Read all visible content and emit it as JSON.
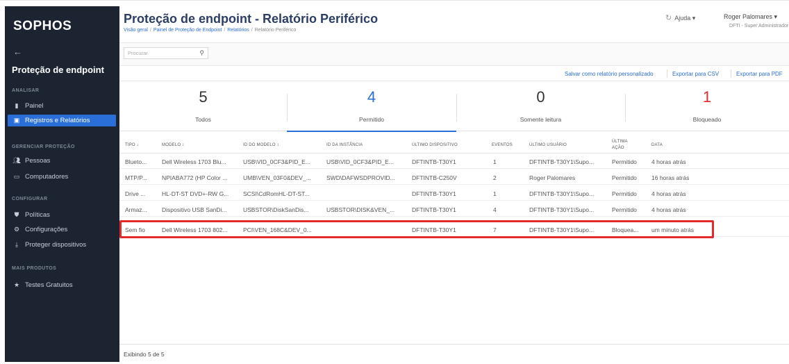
{
  "brand": {
    "logo": "SOPHOS"
  },
  "sidebar": {
    "back": "←",
    "section_title": "Proteção de endpoint",
    "groups": [
      {
        "label": "ANALISAR"
      },
      {
        "label": "GERENCIAR PROTEÇÃO"
      },
      {
        "label": "CONFIGURAR"
      },
      {
        "label": "MAIS PRODUTOS"
      }
    ],
    "items": [
      {
        "label": "Painel",
        "icon": "bar-chart-icon"
      },
      {
        "label": "Registros e Relatórios",
        "icon": "reports-icon",
        "active": true
      },
      {
        "label": "Pessoas",
        "icon": "people-icon"
      },
      {
        "label": "Computadores",
        "icon": "monitor-icon"
      },
      {
        "label": "Políticas",
        "icon": "shield-icon"
      },
      {
        "label": "Configurações",
        "icon": "gear-icon"
      },
      {
        "label": "Proteger dispositivos",
        "icon": "download-icon"
      },
      {
        "label": "Testes Gratuitos",
        "icon": "star-icon"
      }
    ]
  },
  "header": {
    "title": "Proteção de endpoint - Relatório Periférico",
    "breadcrumbs": [
      "Visão geral",
      "Painel de Proteção de Endpoint",
      "Relatórios",
      "Relatório Periférico"
    ],
    "help": "Ajuda ▾",
    "user_name": "Roger Palomares ▾",
    "user_role": "DFTI - Super Administrador"
  },
  "search": {
    "placeholder": "Procurar"
  },
  "actions": {
    "save": "Salvar como relatório personalizado",
    "export_csv": "Exportar para CSV",
    "export_pdf": "Exportar para PDF"
  },
  "stats": [
    {
      "value": "5",
      "label": "Todos",
      "color": "#333333"
    },
    {
      "value": "4",
      "label": "Permitido",
      "color": "#2a6fd8"
    },
    {
      "value": "0",
      "label": "Somente leitura",
      "color": "#333333"
    },
    {
      "value": "1",
      "label": "Bloqueado",
      "color": "#e32a2a"
    }
  ],
  "table": {
    "headers": [
      "TIPO ↓",
      "MODELO ↕",
      "ID DO MODELO ↕",
      "ID DA INSTÂNCIA",
      "ÚLTIMO DISPOSITIVO",
      "EVENTOS",
      "ÚLTIMO USUÁRIO",
      "ÚLTIMA AÇÃO",
      "DATA"
    ],
    "rows": [
      [
        "Blueto...",
        "Dell Wireless 1703 Blu...",
        "USB\\VID_0CF3&PID_E...",
        "USB\\VID_0CF3&PID_E...",
        "DFTINTB-T30Y1",
        "1",
        "DFTINTB-T30Y1\\Supo...",
        "Permitido",
        "4 horas atrás"
      ],
      [
        "MTP/P...",
        "NPIABA772 (HP Color ...",
        "UMB\\VEN_03F0&DEV_...",
        "SWD\\DAFWSDPROVID...",
        "DFTINTB-C250V",
        "2",
        "Roger Palomares",
        "Permitido",
        "16 horas atrás"
      ],
      [
        "Drive ...",
        "HL-DT-ST DVD+-RW G...",
        "SCSI\\CdRomHL-DT-ST...",
        "",
        "DFTINTB-T30Y1",
        "1",
        "DFTINTB-T30Y1\\Supo...",
        "Permitido",
        "4 horas atrás"
      ],
      [
        "Armaz...",
        "Dispositivo USB SanDi...",
        "USBSTOR\\DiskSanDis...",
        "USBSTOR\\DISK&VEN_...",
        "DFTINTB-T30Y1",
        "4",
        "DFTINTB-T30Y1\\Supo...",
        "Permitido",
        "4 horas atrás"
      ],
      [
        "Sem fio",
        "Dell Wireless 1703 802...",
        "PCI\\VEN_168C&DEV_0...",
        "",
        "DFTINTB-T30Y1",
        "7",
        "DFTINTB-T30Y1\\Supo...",
        "Bloquea...",
        "um minuto atrás"
      ]
    ]
  },
  "footer": {
    "text": "Exibindo 5 de 5"
  }
}
